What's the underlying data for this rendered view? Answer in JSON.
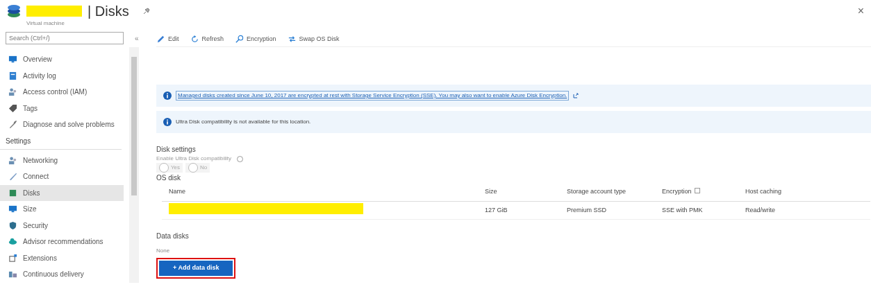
{
  "header": {
    "title": "| Disks",
    "subtitle": "Virtual machine",
    "close": "×"
  },
  "search": {
    "placeholder": "Search (Ctrl+/)"
  },
  "collapse": "«",
  "sidebar": {
    "items": [
      {
        "label": "Overview",
        "selected": false
      },
      {
        "label": "Activity log",
        "selected": false
      },
      {
        "label": "Access control (IAM)",
        "selected": false
      },
      {
        "label": "Tags",
        "selected": false
      },
      {
        "label": "Diagnose and solve problems",
        "selected": false
      }
    ],
    "section": "Settings",
    "settings_items": [
      {
        "label": "Networking",
        "selected": false
      },
      {
        "label": "Connect",
        "selected": false
      },
      {
        "label": "Disks",
        "selected": true
      },
      {
        "label": "Size",
        "selected": false
      },
      {
        "label": "Security",
        "selected": false
      },
      {
        "label": "Advisor recommendations",
        "selected": false
      },
      {
        "label": "Extensions",
        "selected": false
      },
      {
        "label": "Continuous delivery",
        "selected": false
      }
    ]
  },
  "toolbar": [
    {
      "label": "Edit"
    },
    {
      "label": "Refresh"
    },
    {
      "label": "Encryption"
    },
    {
      "label": "Swap OS Disk"
    }
  ],
  "banners": [
    {
      "text": "Managed disks created since June 10, 2017 are encrypted at rest with Storage Service Encryption (SSE). You may also want to enable Azure Disk Encryption.",
      "kind": "link"
    },
    {
      "text": "Ultra Disk compatibility is not available for this location.",
      "kind": "text"
    }
  ],
  "disk_settings": {
    "title": "Disk settings",
    "ultra_label": "Enable Ultra Disk compatibility",
    "options": [
      {
        "label": "Yes",
        "selected": false,
        "disabled": true
      },
      {
        "label": "No",
        "selected": false,
        "disabled": true
      }
    ]
  },
  "os_disk": {
    "title": "OS disk",
    "columns": [
      "Name",
      "Size",
      "Storage account type",
      "Encryption",
      "Host caching"
    ],
    "rows": [
      [
        "",
        "127 GiB",
        "Premium SSD",
        "SSE with PMK",
        "Read/write"
      ]
    ]
  },
  "data_disks": {
    "title": "Data disks",
    "empty": "None",
    "button": "+ Add data disk"
  }
}
